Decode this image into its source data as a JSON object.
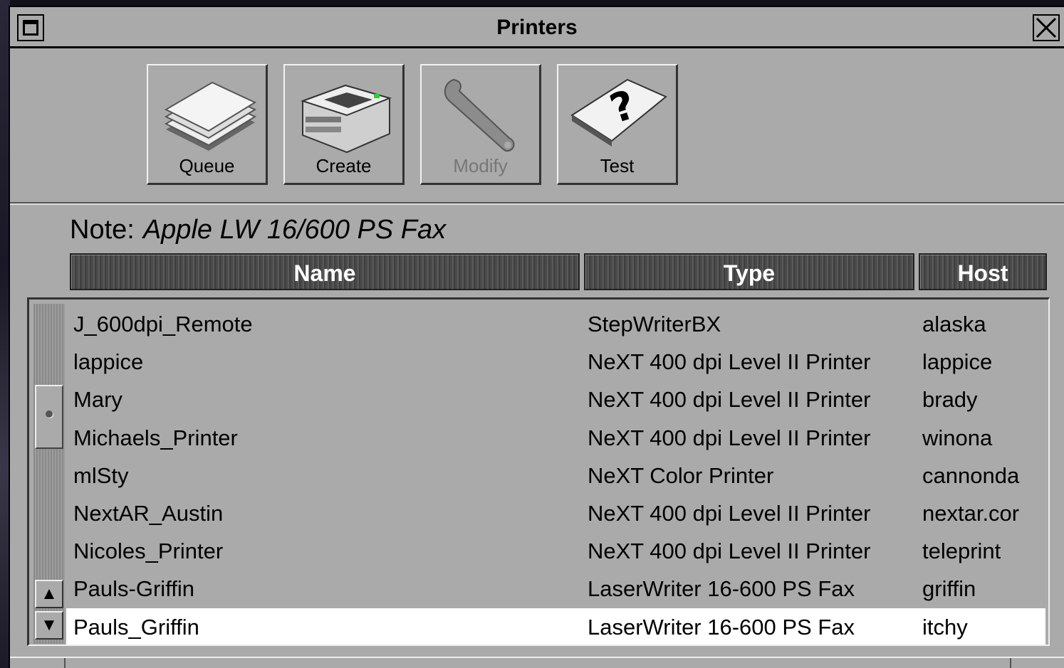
{
  "window": {
    "title": "Printers"
  },
  "toolbar": {
    "queue": {
      "label": "Queue",
      "icon": "paper-stack-icon"
    },
    "create": {
      "label": "Create",
      "icon": "printer-icon"
    },
    "modify": {
      "label": "Modify",
      "icon": "wrench-icon",
      "enabled": false
    },
    "test": {
      "label": "Test",
      "icon": "question-paper-icon"
    }
  },
  "note": {
    "label": "Note:",
    "value": "Apple LW 16/600 PS Fax"
  },
  "columns": {
    "name": "Name",
    "type": "Type",
    "host": "Host"
  },
  "printers": [
    {
      "name": "J_600dpi_Remote",
      "type": "StepWriterBX",
      "host": "alaska"
    },
    {
      "name": "lappice",
      "type": "NeXT 400 dpi Level II Printer",
      "host": "lappice"
    },
    {
      "name": "Mary",
      "type": "NeXT 400 dpi Level II Printer",
      "host": "brady"
    },
    {
      "name": "Michaels_Printer",
      "type": "NeXT 400 dpi Level II Printer",
      "host": "winona"
    },
    {
      "name": "mlSty",
      "type": "NeXT Color Printer",
      "host": "cannonda"
    },
    {
      "name": "NextAR_Austin",
      "type": "NeXT 400 dpi Level II Printer",
      "host": "nextar.cor"
    },
    {
      "name": "Nicoles_Printer",
      "type": "NeXT 400 dpi Level II Printer",
      "host": "teleprint"
    },
    {
      "name": "Pauls-Griffin",
      "type": "LaserWriter 16-600 PS Fax",
      "host": "griffin"
    },
    {
      "name": "Pauls_Griffin",
      "type": "LaserWriter 16-600 PS Fax",
      "host": "itchy",
      "selected": true
    }
  ]
}
